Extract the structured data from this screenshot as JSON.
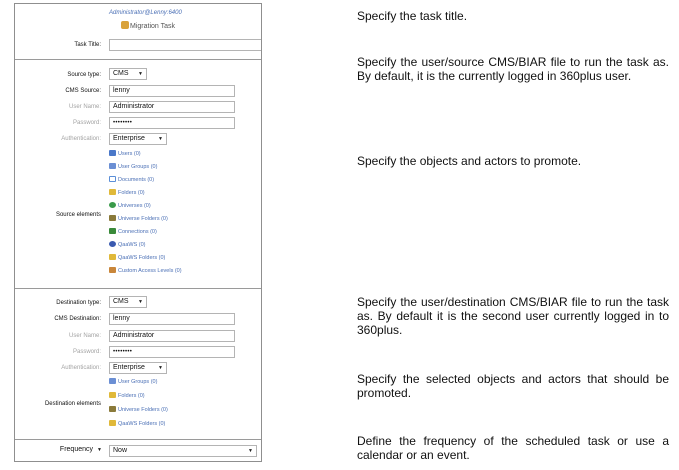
{
  "header": {
    "server": "Administrator@Lenny:6400",
    "task_name": "Migration Task"
  },
  "task": {
    "title_label": "Task Title:",
    "title_value": ""
  },
  "source": {
    "type_label": "Source type:",
    "type_value": "CMS",
    "cms_label": "CMS Source:",
    "cms_value": "lenny",
    "user_label": "User Name:",
    "user_value": "Administrator",
    "password_label": "Password:",
    "password_value": "••••••••",
    "auth_label": "Authentication:",
    "auth_value": "Enterprise",
    "elements_label": "Source elements",
    "elements": [
      {
        "label": "Users (0)",
        "icon": "users-icon",
        "color": "#4a78c9"
      },
      {
        "label": "User Groups (0)",
        "icon": "user-groups-icon",
        "color": "#6b8fd4"
      },
      {
        "label": "Documents (0)",
        "icon": "documents-icon",
        "color": "#5b8fd8"
      },
      {
        "label": "Folders (0)",
        "icon": "folder-icon",
        "color": "#e0b93a"
      },
      {
        "label": "Universes (0)",
        "icon": "universes-icon",
        "color": "#3a9a4a"
      },
      {
        "label": "Universe Folders (0)",
        "icon": "universe-folder-icon",
        "color": "#8a7a3a"
      },
      {
        "label": "Connections (0)",
        "icon": "connections-icon",
        "color": "#3a8a3a"
      },
      {
        "label": "QaaWS (0)",
        "icon": "qaaws-icon",
        "color": "#3a5ab0"
      },
      {
        "label": "QaaWS Folders (0)",
        "icon": "qaaws-folder-icon",
        "color": "#e0b93a"
      },
      {
        "label": "Custom Access Levels (0)",
        "icon": "access-levels-icon",
        "color": "#c9863a"
      }
    ]
  },
  "destination": {
    "type_label": "Destination type:",
    "type_value": "CMS",
    "cms_label": "CMS Destination:",
    "cms_value": "lenny",
    "user_label": "User Name:",
    "user_value": "Administrator",
    "password_label": "Password:",
    "password_value": "••••••••",
    "auth_label": "Authentication:",
    "auth_value": "Enterprise",
    "elements_label": "Destination elements",
    "elements": [
      {
        "label": "User Groups (0)",
        "icon": "user-groups-icon",
        "color": "#6b8fd4"
      },
      {
        "label": "Folders (0)",
        "icon": "folder-icon",
        "color": "#e0b93a"
      },
      {
        "label": "Universe Folders (0)",
        "icon": "universe-folder-icon",
        "color": "#8a7a3a"
      },
      {
        "label": "QaaWS Folders (0)",
        "icon": "qaaws-folder-icon",
        "color": "#e0b93a"
      }
    ]
  },
  "schedule": {
    "frequency_label": "Frequency",
    "frequency_value": "Now"
  },
  "descriptions": [
    "Specify the task title.",
    "Specify the user/source CMS/BIAR file to run the task as. By default, it is the currently logged in 360plus user.",
    "Specify the objects and actors to promote.",
    "Specify the user/destination CMS/BIAR file to run the task as. By default it is the second user currently logged in to 360plus.",
    "Specify the selected objects and actors that should be promoted.",
    "Define the frequency of the scheduled task or use a calendar or an event."
  ]
}
